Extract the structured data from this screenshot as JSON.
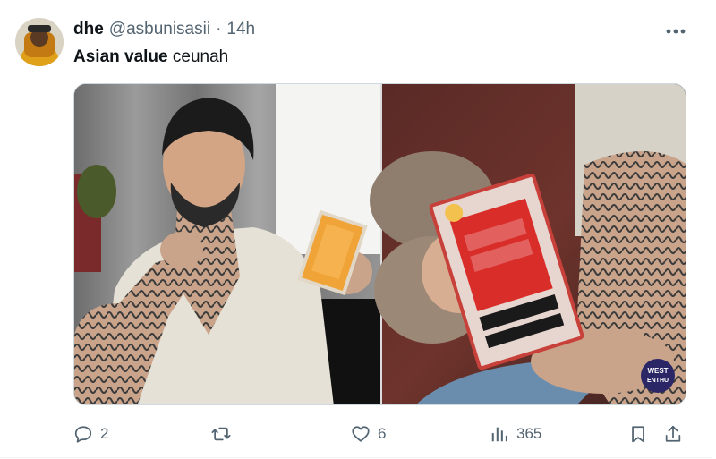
{
  "tweet": {
    "author_name": "dhe",
    "handle": "@asbunisasii",
    "separator": "·",
    "time": "14h",
    "text_bold": "Asian value",
    "text_rest": " ceunah"
  },
  "media": {
    "watermark_line1": "WEST",
    "watermark_line2": "ENTHU"
  },
  "actions": {
    "replies": "2",
    "reposts": "",
    "likes": "6",
    "views": "365"
  },
  "icons": {
    "more": "more-horizontal-icon",
    "reply": "reply-icon",
    "repost": "repost-icon",
    "like": "heart-icon",
    "views": "views-icon",
    "bookmark": "bookmark-icon",
    "share": "share-icon"
  },
  "colors": {
    "text_primary": "#0f1419",
    "text_secondary": "#536471",
    "border": "#cfd9de"
  }
}
